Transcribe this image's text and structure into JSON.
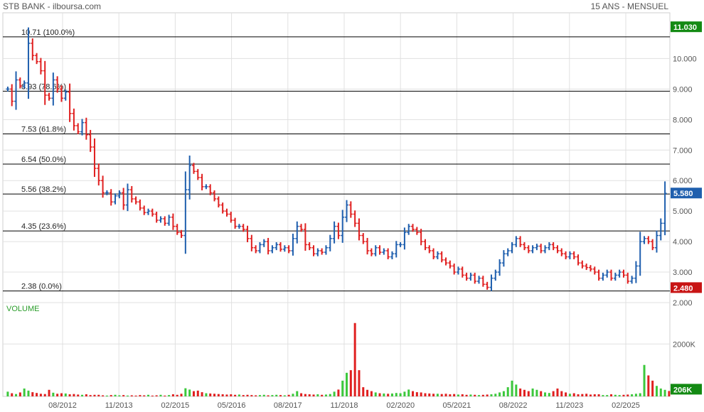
{
  "header": {
    "title": "STB BANK - ilboursa.com",
    "period": "15 ANS - MENSUEL"
  },
  "colors": {
    "up": "#1f5fae",
    "down": "#e02020",
    "volume_up": "#3cc83c",
    "volume_down": "#e02020",
    "grid": "#e0e0e0",
    "fib_line": "#000000",
    "badge_high": "#138a13",
    "badge_last": "#1f5fae",
    "badge_low": "#c81414"
  },
  "chart_data": [
    {
      "type": "candlestick",
      "title": "STB BANK",
      "ylim": [
        2.0,
        11.5
      ],
      "yticks": [
        2.0,
        3.0,
        4.0,
        5.0,
        6.0,
        7.0,
        8.0,
        9.0,
        10.0
      ],
      "ytick_labels": [
        "2.000",
        "3.000",
        "4.000",
        "5.000",
        "6.000",
        "7.000",
        "8.000",
        "9.000",
        "10.000"
      ],
      "x_labels": [
        "08/2012",
        "11/2013",
        "02/2015",
        "05/2016",
        "08/2017",
        "11/2018",
        "02/2020",
        "05/2021",
        "08/2022",
        "11/2023",
        "02/2025"
      ],
      "fibonacci_levels": [
        {
          "value": 10.71,
          "label": "10.71",
          "pct": "(100.0%)"
        },
        {
          "value": 8.93,
          "label": "8.93",
          "pct": "(78.6%)"
        },
        {
          "value": 7.53,
          "label": "7.53",
          "pct": "(61.8%)"
        },
        {
          "value": 6.54,
          "label": "6.54",
          "pct": "(50.0%)"
        },
        {
          "value": 5.56,
          "label": "5.56",
          "pct": "(38.2%)"
        },
        {
          "value": 4.35,
          "label": "4.35",
          "pct": "(23.6%)"
        },
        {
          "value": 2.38,
          "label": "2.38",
          "pct": "(0.0%)"
        }
      ],
      "badges": [
        {
          "value": 11.03,
          "text": "11.030",
          "kind": "high"
        },
        {
          "value": 5.58,
          "text": "5.580",
          "kind": "last"
        },
        {
          "value": 2.48,
          "text": "2.480",
          "kind": "low"
        }
      ],
      "series": [
        {
          "name": "",
          "values": [
            9.0,
            8.6,
            9.3,
            9.1,
            9.2,
            10.5,
            10.1,
            9.9,
            9.6,
            8.8,
            8.7,
            9.3,
            9.0,
            8.7,
            8.9,
            8.2,
            7.8,
            7.6,
            7.9,
            7.5,
            7.1,
            6.4,
            6.0,
            5.6,
            5.6,
            5.3,
            5.5,
            5.6,
            5.2,
            5.7,
            5.4,
            5.3,
            5.1,
            4.95,
            5.0,
            4.9,
            4.7,
            4.75,
            4.6,
            4.8,
            4.5,
            4.3,
            4.2,
            5.7,
            6.5,
            6.3,
            6.1,
            5.8,
            5.8,
            5.6,
            5.4,
            5.2,
            5.0,
            4.9,
            4.7,
            4.5,
            4.5,
            4.4,
            4.1,
            3.8,
            3.7,
            3.9,
            4.0,
            3.7,
            3.8,
            3.9,
            3.75,
            3.8,
            3.7,
            4.1,
            4.5,
            4.4,
            3.9,
            3.8,
            3.6,
            3.7,
            3.65,
            3.8,
            4.1,
            4.5,
            4.2,
            4.8,
            5.2,
            4.9,
            4.6,
            4.2,
            4.0,
            3.7,
            3.6,
            3.8,
            3.65,
            3.7,
            3.5,
            3.6,
            3.9,
            3.9,
            4.3,
            4.5,
            4.4,
            4.3,
            4.0,
            3.8,
            3.7,
            3.5,
            3.6,
            3.4,
            3.3,
            3.2,
            3.0,
            3.1,
            2.9,
            2.8,
            2.9,
            2.7,
            2.8,
            2.6,
            2.5,
            2.8,
            3.0,
            3.3,
            3.6,
            3.7,
            3.9,
            4.1,
            3.9,
            3.8,
            3.7,
            3.8,
            3.85,
            3.7,
            3.8,
            3.9,
            3.8,
            3.7,
            3.6,
            3.5,
            3.6,
            3.5,
            3.3,
            3.2,
            3.15,
            3.1,
            3.0,
            2.8,
            2.9,
            3.0,
            2.8,
            2.9,
            3.0,
            2.9,
            2.7,
            2.8,
            3.2,
            4.0,
            4.1,
            4.0,
            3.8,
            4.2,
            4.6,
            5.58
          ]
        }
      ]
    },
    {
      "type": "bar",
      "title": "VOLUME",
      "ylim": [
        0,
        3200
      ],
      "yticks": [
        2000
      ],
      "ytick_labels": [
        "2000K"
      ],
      "last_label": "206K",
      "series": [
        {
          "name": "VOLUME",
          "values": [
            180,
            120,
            90,
            150,
            300,
            220,
            160,
            130,
            100,
            90,
            250,
            140,
            100,
            120,
            110,
            80,
            90,
            70,
            60,
            80,
            50,
            60,
            60,
            40,
            30,
            50,
            60,
            40,
            50,
            30,
            40,
            30,
            50,
            40,
            60,
            30,
            40,
            60,
            30,
            50,
            80,
            60,
            100,
            310,
            260,
            200,
            220,
            160,
            120,
            110,
            100,
            90,
            80,
            70,
            80,
            60,
            70,
            50,
            60,
            50,
            40,
            50,
            60,
            40,
            50,
            60,
            50,
            40,
            60,
            100,
            200,
            120,
            90,
            80,
            70,
            80,
            60,
            70,
            90,
            180,
            260,
            600,
            900,
            1000,
            2800,
            1000,
            350,
            250,
            200,
            150,
            120,
            110,
            100,
            110,
            130,
            120,
            180,
            260,
            200,
            160,
            150,
            120,
            110,
            100,
            100,
            90,
            100,
            80,
            90,
            70,
            80,
            60,
            70,
            60,
            50,
            60,
            70,
            80,
            100,
            150,
            200,
            350,
            600,
            450,
            300,
            250,
            200,
            300,
            250,
            200,
            150,
            130,
            200,
            300,
            200,
            150,
            100,
            120,
            80,
            90,
            100,
            70,
            80,
            80,
            50,
            50,
            80,
            60,
            50,
            60,
            70,
            80,
            100,
            120,
            1200,
            800,
            600,
            400,
            300,
            250,
            206
          ]
        }
      ]
    }
  ]
}
